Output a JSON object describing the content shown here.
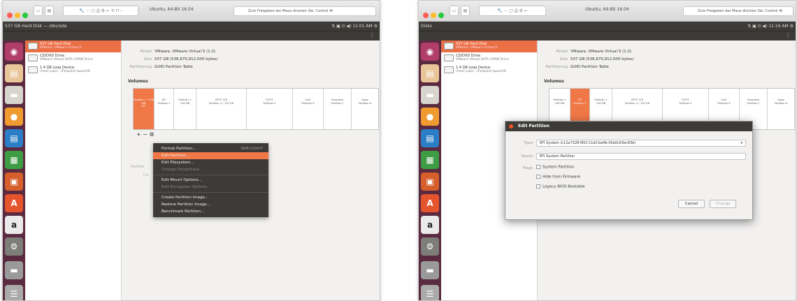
{
  "left_window": {
    "tab_label": "Ubuntu, 64-Bit 16.04",
    "url_text": "Zum Freigeben der Maus drücken Sie: Control ⌘",
    "ubuntu_title": "537 GB Hard Disk — /dev/sda",
    "indicator_text": "⇅ ▣ ⏻ ◀) 11:01 AM ⚙",
    "drives": [
      {
        "title": "537 GB Hard Disk",
        "sub": "VMware, VMware Virtual S"
      },
      {
        "title": "CD/DVD Drive",
        "sub": "VMware Virtual SATA CDRW Drive"
      },
      {
        "title": "1.4 GB Loop Device",
        "sub": "/root/.cups/.../Firepoint-squashfs"
      }
    ],
    "details": {
      "model_label": "Model",
      "model_value": "VMware, VMware Virtual S (1.0)",
      "size_label": "Size",
      "size_value": "537 GB (536,870,912,000 bytes)",
      "part_label": "Partitioning",
      "part_value": "GUID Partition Table"
    },
    "volumes_label": "Volumes",
    "segments": [
      "Partition 1 • 538 MB\nEFI",
      "EFI\nPartition 2",
      "Partition 3\n128 MB",
      "NTFS 128\nPartition 4 • 100 GB",
      "FAT32\nPartition 5",
      "Ext4\nPartition 6",
      "Extended\nPartition 7",
      "Swap\nPartition 8"
    ],
    "vol_buttons": "+ − ⚙",
    "partial_labels": {
      "a": "Partitio",
      "b": "Co"
    },
    "context_menu": [
      {
        "label": "Format Partition…",
        "shortcut": "Shift+Ctrl+F",
        "state": "normal"
      },
      {
        "label": "Edit Partition…",
        "shortcut": "",
        "state": "highlight"
      },
      {
        "label": "Edit Filesystem…",
        "shortcut": "",
        "state": "normal"
      },
      {
        "label": "Change Passphrase…",
        "shortcut": "",
        "state": "disabled"
      },
      {
        "label": "Edit Mount Options…",
        "shortcut": "",
        "state": "normal"
      },
      {
        "label": "Edit Encryption Options…",
        "shortcut": "",
        "state": "disabled"
      },
      {
        "label": "Create Partition Image…",
        "shortcut": "",
        "state": "normal"
      },
      {
        "label": "Restore Partition Image…",
        "shortcut": "",
        "state": "normal"
      },
      {
        "label": "Benchmark Partition…",
        "shortcut": "",
        "state": "normal"
      }
    ]
  },
  "right_window": {
    "tab_label": "Ubuntu, 64-Bit 16.04",
    "url_text": "Zum Freigeben der Maus drücken Sie: Control ⌘",
    "ubuntu_title": "Disks",
    "indicator_text": "⇅ ▣ ⏻ ◀) 11:16 AM ⚙",
    "drives": [
      {
        "title": "537 GB Hard Disk",
        "sub": "VMware, VMware Virtual S"
      },
      {
        "title": "CD/DVD Drive",
        "sub": "VMware Virtual SATA CDRW Drive"
      },
      {
        "title": "1.4 GB Loop Device",
        "sub": "/root/.cups/.../Firepoint-squashfs"
      }
    ],
    "details": {
      "model_label": "Model",
      "model_value": "VMware, VMware Virtual S (1.0)",
      "size_label": "Size",
      "size_value": "537 GB (536,870,912,000 bytes)",
      "part_label": "Partitioning",
      "part_value": "GUID Partition Table"
    },
    "volumes_label": "Volumes",
    "segments": [
      "Partition 1\n538 MB",
      "EFI\nPartition 2",
      "Partition 3\n128 MB",
      "NTFS 128\nPartition 4 • 100 GB",
      "FAT32\nPartition 5",
      "Ext4\nPartition 6",
      "Extended\nPartition 7",
      "Swap\nPartition 8"
    ],
    "dialog": {
      "title": "Edit Partition",
      "type_label": "Type",
      "type_value": "EFI System (c12a7328-f81f-11d2-ba4b-00a0c93ec93b)",
      "name_label": "Name",
      "name_value": "EFI System Partition",
      "flags_label": "Flags",
      "flag1": "System Partition",
      "flag2": "Hide from Firmware",
      "flag3": "Legacy BIOS Bootable",
      "cancel": "Cancel",
      "change": "Change"
    }
  },
  "colors": {
    "accent": "#f07746",
    "launcher": "#5a2b40",
    "panel": "#3c3b37"
  }
}
